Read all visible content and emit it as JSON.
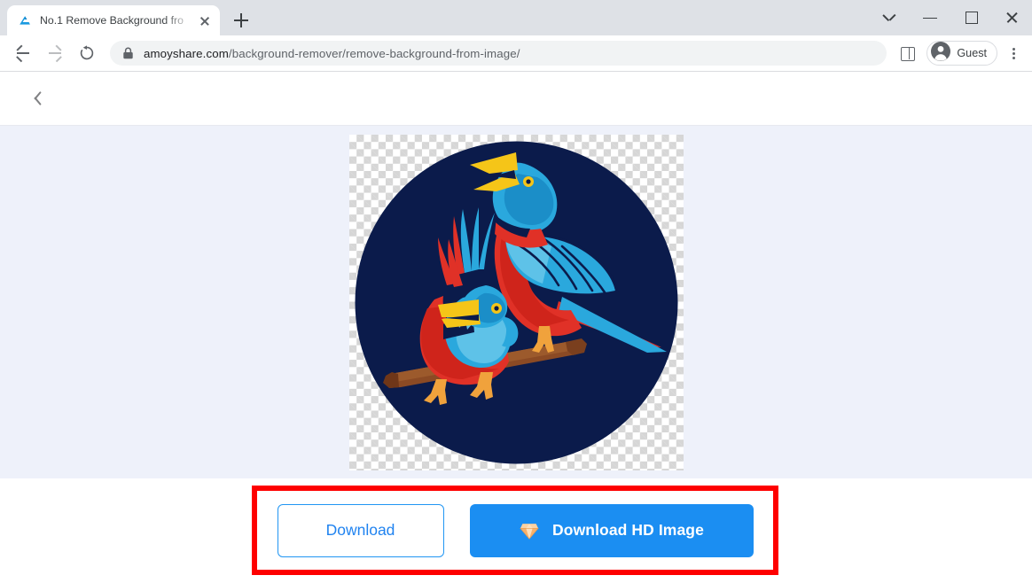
{
  "browser": {
    "tab": {
      "title": "No.1 Remove Background fro",
      "favicon_name": "amoyshare-logo-icon",
      "close_label": "Close tab"
    },
    "new_tab_label": "New Tab",
    "window_controls": {
      "search_tabs": "Search tabs",
      "minimize": "Minimize",
      "maximize": "Maximize",
      "close": "Close"
    },
    "toolbar": {
      "back": "Back",
      "forward": "Forward",
      "reload": "Reload",
      "url_domain": "amoyshare.com",
      "url_path": "/background-remover/remove-background-from-image/",
      "url_full": "amoyshare.com/background-remover/remove-background-from-image/",
      "lock_label": "View site information",
      "side_panel": "Side panel",
      "profile_label": "Guest",
      "menu_label": "Customize and control Google Chrome"
    }
  },
  "page": {
    "header": {
      "back_label": "Back"
    },
    "preview": {
      "alt": "Two birds perched on a branch inside a dark navy circle, background removed",
      "transparency_checkerboard": true,
      "circle_color": "#0b1b4b",
      "bird_red": "#e03127",
      "bird_blue": "#2aa8dd",
      "bird_teal": "#1b7fb5",
      "beak_yellow": "#f5c518",
      "branch_brown": "#8b4a24",
      "foot_orange": "#f0a23c"
    },
    "actions": {
      "highlight_color": "#fe0000",
      "download": {
        "label": "Download",
        "accent": "#2083f0"
      },
      "download_hd": {
        "label": "Download HD Image",
        "icon_name": "gem-diamond-icon",
        "background": "#1b8ef2",
        "text_color": "#ffffff"
      }
    }
  }
}
